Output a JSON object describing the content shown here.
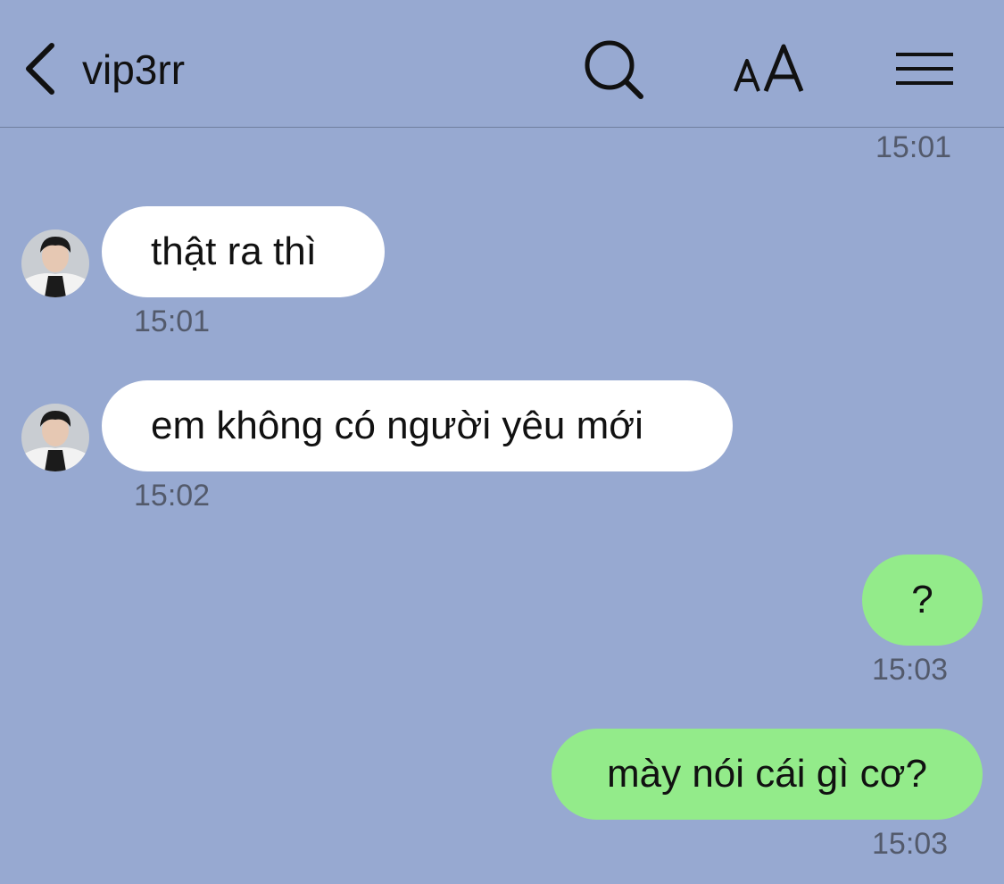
{
  "header": {
    "title": "vip3rr"
  },
  "chat": {
    "top_time": "15:01",
    "messages": [
      {
        "direction": "in",
        "text": "thật ra thì",
        "time": "15:01"
      },
      {
        "direction": "in",
        "text": "em không có người yêu mới",
        "time": "15:02"
      },
      {
        "direction": "out",
        "text": "?",
        "time": "15:03"
      },
      {
        "direction": "out",
        "text": "mày nói cái gì cơ?",
        "time": "15:03"
      }
    ]
  },
  "icons": [
    "chevron-left-icon",
    "search-icon",
    "font-size-icon",
    "menu-icon",
    "avatar"
  ],
  "colors": {
    "background": "#97a9d1",
    "incoming_bubble": "#ffffff",
    "outgoing_bubble": "#93eb8a",
    "timestamp": "#535a6b"
  }
}
